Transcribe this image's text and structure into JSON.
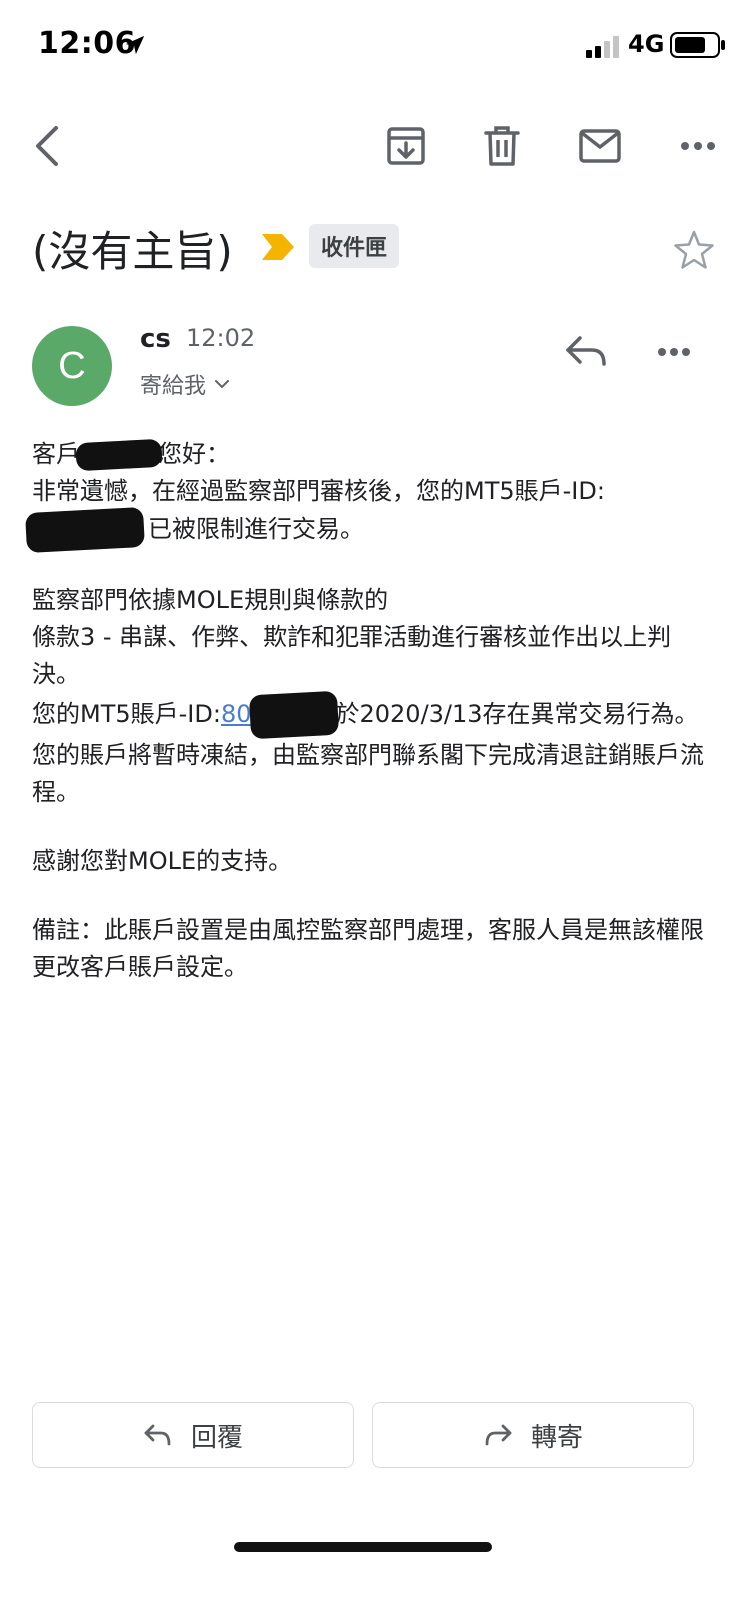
{
  "status_bar": {
    "time": "12:06",
    "network": "4G",
    "icons": [
      "location-arrow-icon",
      "signal-icon",
      "battery-icon"
    ]
  },
  "toolbar": {
    "icons": [
      "back-icon",
      "archive-icon",
      "delete-icon",
      "mail-icon",
      "more-icon"
    ]
  },
  "email": {
    "subject": "(沒有主旨)",
    "label": "收件匣",
    "sender": "cs",
    "time": "12:02",
    "recipient": "寄給我"
  },
  "body": {
    "l1a": "客戶",
    "l1b": "您好：",
    "l2": "非常遺憾，在經過監察部門審核後，您的MT5賬戶-ID:",
    "l3": "已被限制進行交易。",
    "l4": "監察部門依據MOLE規則與條款的",
    "l5": "條款3 - 串謀、作弊、欺詐和犯罪活動進行審核並作出以上判決。",
    "l6a": "您的MT5賬戶-ID:",
    "l6link": "80",
    "l6b": "於2020/3/13存在異常交易行為。",
    "l7": "您的賬戶將暫時凍結，由監察部門聯系閣下完成清退註銷賬戶流程。",
    "l8": "感謝您對MOLE的支持。",
    "l9": "備註：此賬戶設置是由風控監察部門處理，客服人員是無該權限更改客戶賬戶設定。"
  },
  "actions": {
    "reply": "回覆",
    "forward": "轉寄"
  },
  "colors": {
    "avatar": "#5aa969",
    "importance": "#f4b400",
    "link": "#4a7bd0",
    "label_bg": "#e8eaed"
  }
}
